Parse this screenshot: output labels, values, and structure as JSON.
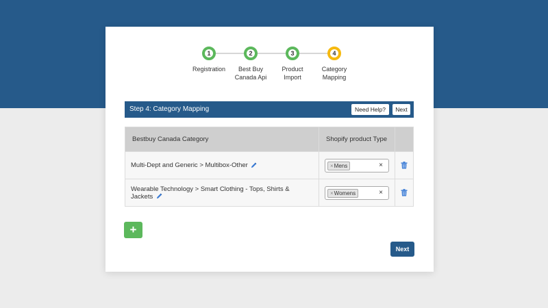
{
  "steps": [
    {
      "number": "1",
      "label": "Registration",
      "status": "complete"
    },
    {
      "number": "2",
      "label": "Best Buy Canada Api",
      "status": "complete"
    },
    {
      "number": "3",
      "label": "Product Import",
      "status": "complete"
    },
    {
      "number": "4",
      "label": "Category Mapping",
      "status": "active"
    }
  ],
  "header": {
    "title": "Step 4: Category Mapping",
    "help_label": "Need Help?",
    "next_label": "Next"
  },
  "table": {
    "columns": [
      "Bestbuy Canada Category",
      "Shopify product Type"
    ],
    "rows": [
      {
        "category": "Multi-Dept and Generic > Multibox-Other",
        "type_tag": "Mens",
        "tag_remove": "×",
        "clear": "×"
      },
      {
        "category": "Wearable Technology > Smart Clothing - Tops, Shirts & Jackets",
        "type_tag": "Womens",
        "tag_remove": "×",
        "clear": "×"
      }
    ]
  },
  "add_button": {
    "icon": "plus-icon",
    "label": "+"
  },
  "footer": {
    "next_label": "Next"
  },
  "colors": {
    "brand_blue": "#265a8a",
    "complete_green": "#5cb85c",
    "active_amber": "#f6b90f",
    "page_bg": "#ececec"
  }
}
